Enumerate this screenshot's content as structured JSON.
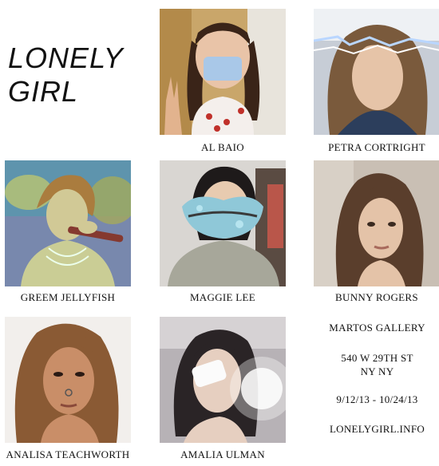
{
  "poster": {
    "title_line1": "LONELY",
    "title_line2": "GIRL"
  },
  "artists": [
    {
      "name": "AL BAIO",
      "icon": "portrait-face-mask-peace-sign"
    },
    {
      "name": "PETRA CORTRIGHT",
      "icon": "portrait-lightning"
    },
    {
      "name": "GREEM JELLYFISH",
      "icon": "portrait-microphone-glitch"
    },
    {
      "name": "MAGGIE LEE",
      "icon": "portrait-blue-lips"
    },
    {
      "name": "BUNNY ROGERS",
      "icon": "portrait"
    },
    {
      "name": "ANALISA TEACHWORTH",
      "icon": "portrait-nose-ring"
    },
    {
      "name": "AMALIA ULMAN",
      "icon": "portrait-eye-bandage-selfie"
    }
  ],
  "info": {
    "gallery": "MARTOS GALLERY",
    "address_line1": "540 W 29TH ST",
    "address_line2": "NY NY",
    "dates": "9/12/13 - 10/24/13",
    "website": "LONELYGIRL.INFO"
  }
}
